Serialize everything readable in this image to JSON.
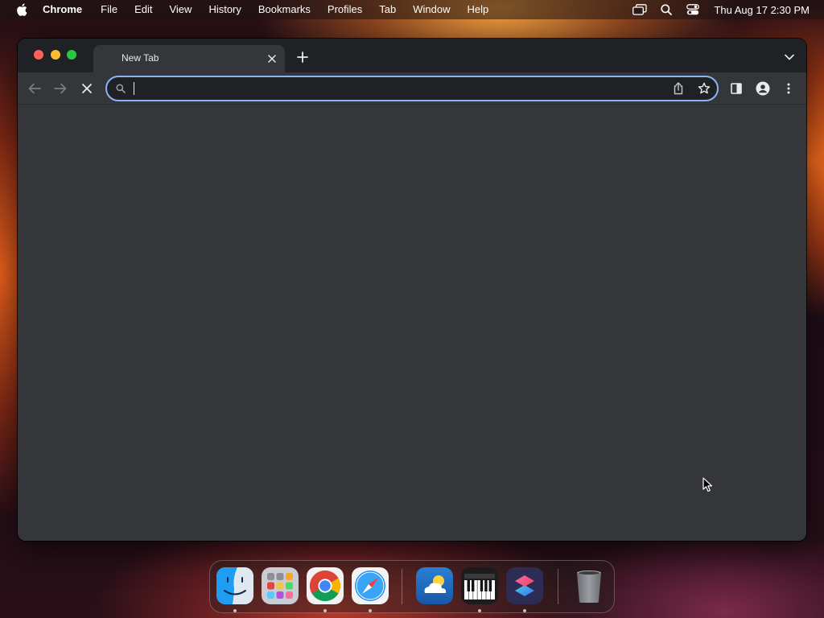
{
  "menubar": {
    "app_name": "Chrome",
    "items": [
      "File",
      "Edit",
      "View",
      "History",
      "Bookmarks",
      "Profiles",
      "Tab",
      "Window",
      "Help"
    ],
    "status_icons": [
      "screen-mirroring-icon",
      "spotlight-search-icon",
      "control-center-icon"
    ],
    "clock": "Thu Aug 17  2:30 PM"
  },
  "window": {
    "tab": {
      "title": "New Tab"
    },
    "omnibox": {
      "value": "",
      "placeholder": ""
    },
    "colors": {
      "frame": "#202124",
      "toolbar": "#35363a",
      "omnibox_focus": "#8ab4f8",
      "close": "#ff5f57",
      "minimize": "#febc2e",
      "maximize": "#28c840"
    }
  },
  "dock": {
    "apps": [
      "finder-icon",
      "launchpad-icon",
      "chrome-icon",
      "safari-icon",
      "weather-icon",
      "piano-icon",
      "shortcuts-icon"
    ],
    "running": [
      "finder-icon",
      "chrome-icon",
      "safari-icon",
      "piano-icon",
      "shortcuts-icon"
    ],
    "trash": "trash-icon"
  }
}
